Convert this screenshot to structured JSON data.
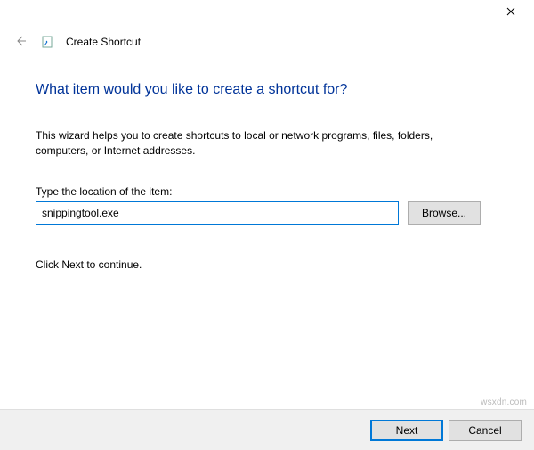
{
  "window": {
    "title": "Create Shortcut"
  },
  "main": {
    "heading": "What item would you like to create a shortcut for?",
    "description": "This wizard helps you to create shortcuts to local or network programs, files, folders, computers, or Internet addresses.",
    "location_label": "Type the location of the item:",
    "location_value": "snippingtool.exe",
    "browse_label": "Browse...",
    "hint": "Click Next to continue."
  },
  "footer": {
    "next_label": "Next",
    "cancel_label": "Cancel"
  },
  "watermark": "wsxdn.com"
}
